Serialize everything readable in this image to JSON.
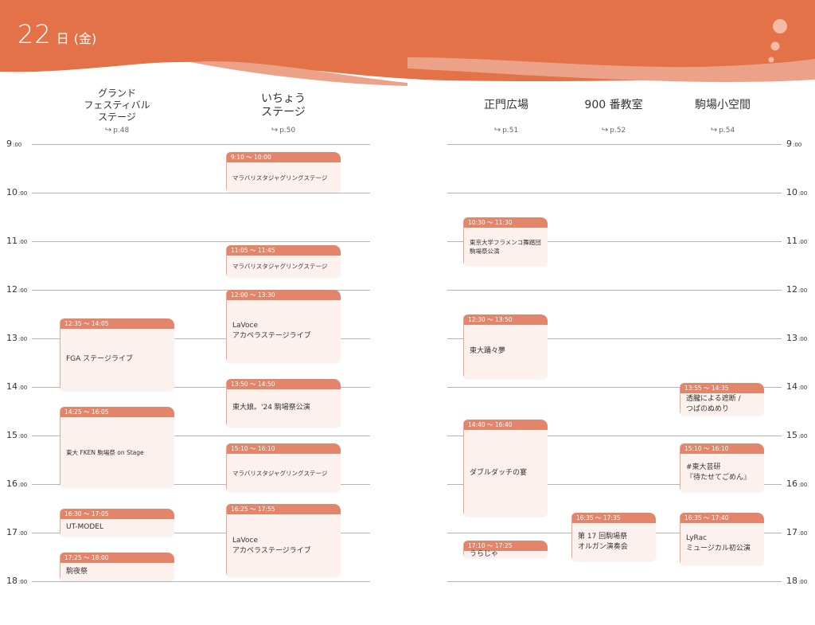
{
  "header": {
    "date_number": "22",
    "date_suffix": "日",
    "weekday": "(金)"
  },
  "colors": {
    "accent": "#e2734a",
    "event_bar": "#e2856a",
    "event_bg": "#fdf1ee"
  },
  "columns": [
    {
      "name": "グランド\nフェスティバル\nステージ",
      "ref": "p.48"
    },
    {
      "name": "いちょう\nステージ",
      "ref": "p.50"
    },
    {
      "name": "正門広場",
      "ref": "p.51"
    },
    {
      "name": "900 番教室",
      "ref": "p.52"
    },
    {
      "name": "駒場小空間",
      "ref": "p.54"
    }
  ],
  "hours": [
    {
      "h": "9",
      "m": ":00"
    },
    {
      "h": "10",
      "m": ":00"
    },
    {
      "h": "11",
      "m": ":00"
    },
    {
      "h": "12",
      "m": ":00"
    },
    {
      "h": "13",
      "m": ":00"
    },
    {
      "h": "14",
      "m": ":00"
    },
    {
      "h": "15",
      "m": ":00"
    },
    {
      "h": "16",
      "m": ":00"
    },
    {
      "h": "17",
      "m": ":00"
    },
    {
      "h": "18",
      "m": ":00"
    }
  ],
  "events": [
    {
      "col": 0,
      "time": "12:35 〜 14:05",
      "title": "FGA ステージライブ"
    },
    {
      "col": 0,
      "time": "14:25 〜 16:05",
      "title": "東大 FKEN 駒場祭 on Stage"
    },
    {
      "col": 0,
      "time": "16:30 〜 17:05",
      "title": "UT-MODEL"
    },
    {
      "col": 0,
      "time": "17:25 〜 18:00",
      "title": "駒夜祭"
    },
    {
      "col": 1,
      "time": "9:10 〜 10:00",
      "title": "マラバリスタジャグリングステージ"
    },
    {
      "col": 1,
      "time": "11:05 〜 11:45",
      "title": "マラバリスタジャグリングステージ"
    },
    {
      "col": 1,
      "time": "12:00 〜 13:30",
      "title": "LaVoce\nアカペラステージライブ"
    },
    {
      "col": 1,
      "time": "13:50 〜 14:50",
      "title": "東大娘。'24 駒場祭公演"
    },
    {
      "col": 1,
      "time": "15:10 〜 16:10",
      "title": "マラバリスタジャグリングステージ"
    },
    {
      "col": 1,
      "time": "16:25 〜 17:55",
      "title": "LaVoce\nアカペラステージライブ"
    },
    {
      "col": 2,
      "time": "10:30 〜 11:30",
      "title": "東京大学フラメンコ舞踏団\n駒場祭公演"
    },
    {
      "col": 2,
      "time": "12:30 〜 13:50",
      "title": "東大踊々夢"
    },
    {
      "col": 2,
      "time": "14:40 〜 16:40",
      "title": "ダブルダッチの宴"
    },
    {
      "col": 2,
      "time": "17:10 〜 17:25",
      "title": "うらじゃ"
    },
    {
      "col": 3,
      "time": "16:35 〜 17:35",
      "title": "第 17 回駒場祭\nオルガン演奏会"
    },
    {
      "col": 4,
      "time": "13:55 〜 14:35",
      "title": "透朧による遮断 /\nつばのぬめり"
    },
    {
      "col": 4,
      "time": "15:10 〜 16:10",
      "title": "#東大芸研\n『待たせてごめん』"
    },
    {
      "col": 4,
      "time": "16:35 〜 17:40",
      "title": "LyRac\nミュージカル初公演"
    }
  ]
}
